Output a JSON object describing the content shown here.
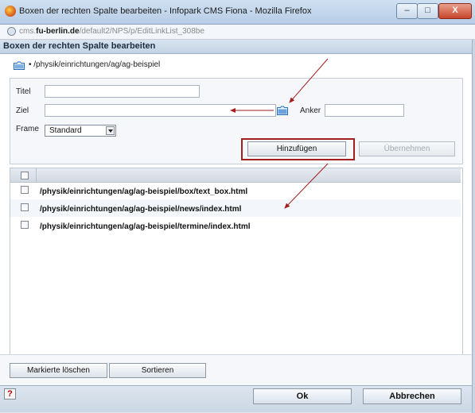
{
  "window": {
    "title": "Boxen der rechten Spalte bearbeiten - Infopark CMS Fiona - Mozilla Firefox",
    "minimize": "–",
    "maximize": "□",
    "close": "X"
  },
  "urlbar": {
    "host_prefix": "cms.",
    "host_bold": "fu-berlin.de",
    "path": "/default2/NPS/p/EditLinkList_308be"
  },
  "dialog": {
    "header": "Boxen der rechten Spalte bearbeiten",
    "path": "• /physik/einrichtungen/ag/ag-beispiel"
  },
  "form": {
    "titel_label": "Titel",
    "titel_value": "",
    "ziel_label": "Ziel",
    "ziel_value": "",
    "anker_label": "Anker",
    "anker_value": "",
    "frame_label": "Frame",
    "frame_value": "Standard",
    "add_button": "Hinzufügen",
    "apply_button": "Übernehmen"
  },
  "list": {
    "items": [
      {
        "path": "/physik/einrichtungen/ag/ag-beispiel/box/text_box.html"
      },
      {
        "path": "/physik/einrichtungen/ag/ag-beispiel/news/index.html"
      },
      {
        "path": "/physik/einrichtungen/ag/ag-beispiel/termine/index.html"
      }
    ]
  },
  "bottom": {
    "delete_marked": "Markierte löschen",
    "sort": "Sortieren"
  },
  "footer": {
    "help": "?",
    "ok": "Ok",
    "cancel": "Abbrechen"
  },
  "colors": {
    "annotation": "#a31e1e"
  }
}
